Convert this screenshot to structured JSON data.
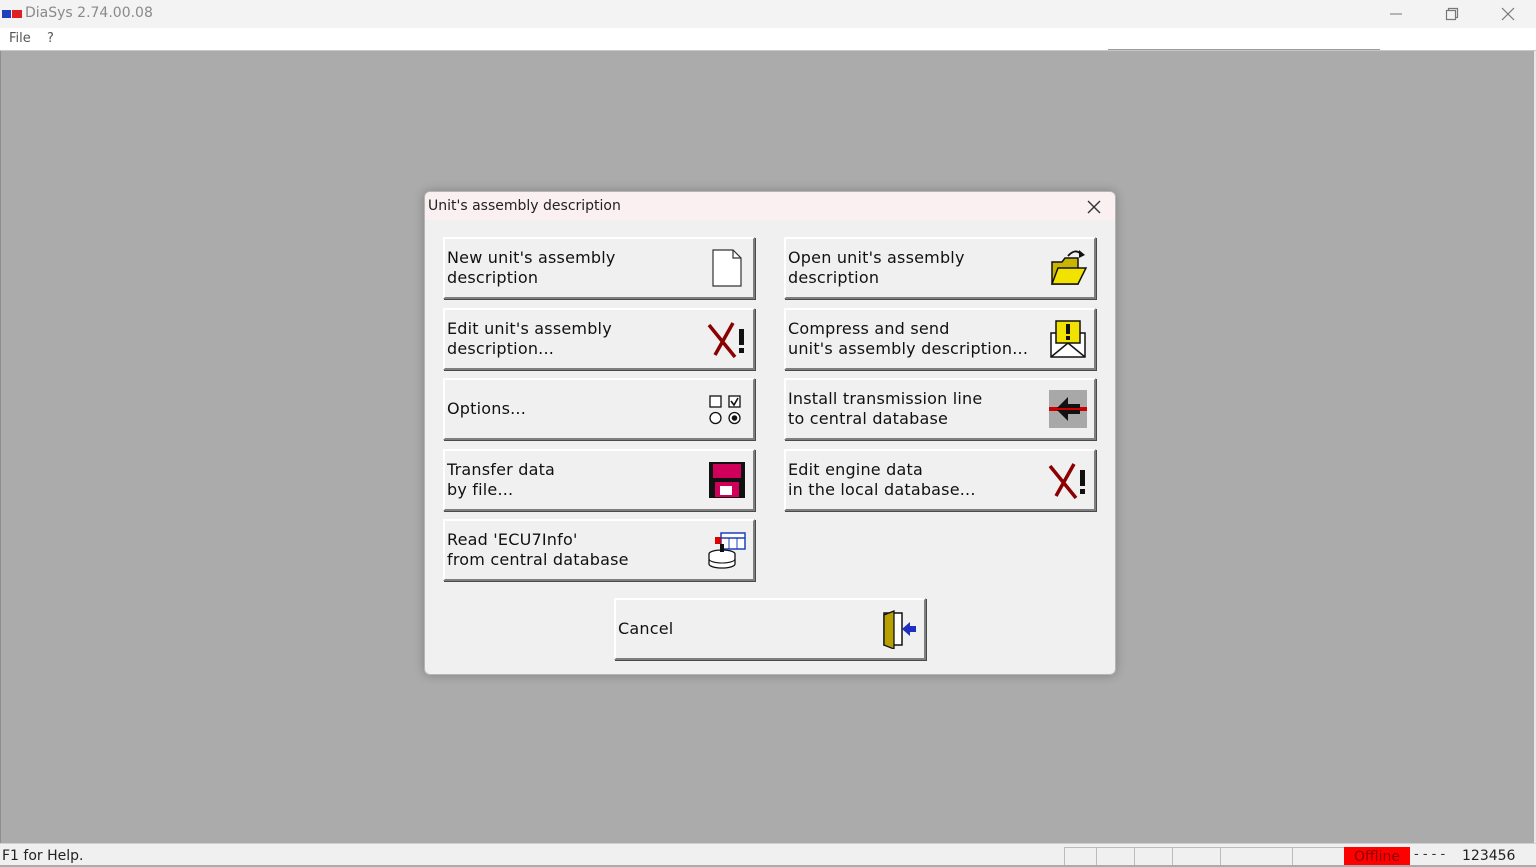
{
  "window": {
    "title": "DiaSys 2.74.00.08",
    "icon": "app-flag-logo",
    "controls": [
      "minimize-icon",
      "restore-icon",
      "close-icon"
    ]
  },
  "menu": {
    "items": [
      {
        "label": "File"
      },
      {
        "label": "?"
      }
    ]
  },
  "dialog": {
    "title": "Unit's assembly description",
    "buttons": [
      {
        "label": "New unit's assembly\ndescription",
        "icon": "new-document-icon"
      },
      {
        "label": "Open unit's assembly\ndescription",
        "icon": "open-folder-icon"
      },
      {
        "label": "Edit unit's assembly\ndescription...",
        "icon": "edit-cross-icon"
      },
      {
        "label": "Compress and send\nunit's assembly description...",
        "icon": "compress-send-envelope-icon"
      },
      {
        "label": "Options...",
        "icon": "options-checkbox-radio-icon"
      },
      {
        "label": "Install transmission line\nto central database",
        "icon": "transmission-line-icon"
      },
      {
        "label": "Transfer data\nby file...",
        "icon": "floppy-disk-icon"
      },
      {
        "label": "Edit engine data\nin the local database...",
        "icon": "edit-cross-icon"
      },
      {
        "label": "Read 'ECU7Info'\nfrom central database",
        "icon": "database-read-icon"
      }
    ],
    "cancel": {
      "label": "Cancel",
      "icon": "exit-door-icon"
    }
  },
  "statusbar": {
    "help": "F1 for Help.",
    "status": "Offline",
    "dashes": "- - - -",
    "code": "123456"
  },
  "colors": {
    "workspace": "#ababab",
    "offline": "#ff0000",
    "dialog_title_bg": "#faf0f2"
  }
}
